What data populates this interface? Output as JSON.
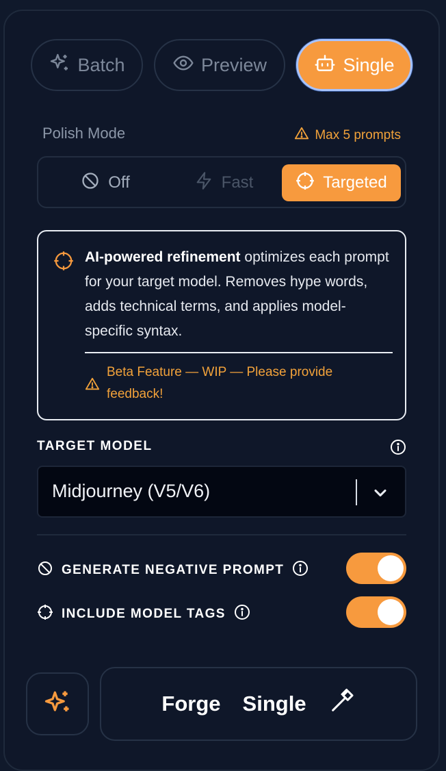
{
  "modes": [
    {
      "label": "Batch",
      "icon": "sparkles-icon",
      "active": false
    },
    {
      "label": "Preview",
      "icon": "eye-icon",
      "active": false
    },
    {
      "label": "Single",
      "icon": "robot-icon",
      "active": true
    }
  ],
  "polish": {
    "label": "Polish Mode",
    "warning": "Max 5 prompts",
    "options": [
      {
        "label": "Off",
        "icon": "ban-icon",
        "state": "normal"
      },
      {
        "label": "Fast",
        "icon": "zap-icon",
        "state": "disabled"
      },
      {
        "label": "Targeted",
        "icon": "crosshair-icon",
        "state": "active"
      }
    ]
  },
  "info": {
    "bold": "AI-powered refinement",
    "body": "optimizes each prompt for your target model. Removes hype words, adds technical terms, and applies model-specific syntax.",
    "beta": "Beta Feature — WIP — Please provide feedback!"
  },
  "target_model": {
    "label": "TARGET MODEL",
    "value": "Midjourney (V5/V6)"
  },
  "toggles": [
    {
      "label": "GENERATE NEGATIVE PROMPT",
      "icon": "ban-icon",
      "on": true
    },
    {
      "label": "INCLUDE MODEL TAGS",
      "icon": "crosshair-icon",
      "on": true
    }
  ],
  "actions": {
    "forge_word": "Forge",
    "forge_mode": "Single"
  },
  "colors": {
    "accent": "#f79a3e",
    "warning": "#f2a23a",
    "background": "#10192b"
  }
}
